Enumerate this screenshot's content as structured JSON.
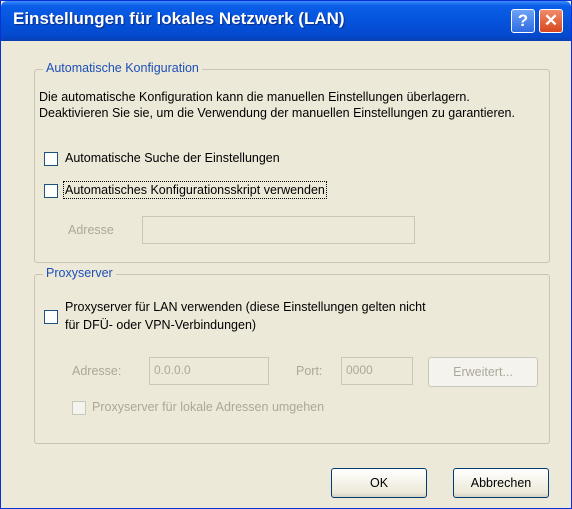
{
  "dialog": {
    "title": "Einstellungen für lokales Netzwerk (LAN)",
    "help_glyph": "?",
    "close_glyph": "✕"
  },
  "auto_config": {
    "group_label": "Automatische Konfiguration",
    "description": "Die automatische Konfiguration kann die manuellen Einstellungen überlagern. Deaktivieren Sie sie, um die Verwendung der manuellen Einstellungen zu garantieren.",
    "auto_detect_label": "Automatische Suche der Einstellungen",
    "auto_detect_checked": false,
    "use_script_label": "Automatisches Konfigurationsskript verwenden",
    "use_script_checked": false,
    "address_label": "Adresse",
    "address_value": ""
  },
  "proxy": {
    "group_label": "Proxyserver",
    "use_proxy_label_line1": "Proxyserver für LAN verwenden (diese Einstellungen gelten nicht",
    "use_proxy_label_line2": "für DFÜ- oder VPN-Verbindungen)",
    "use_proxy_checked": false,
    "address_label": "Adresse:",
    "address_value": "0.0.0.0",
    "port_label": "Port:",
    "port_value": "0000",
    "advanced_label": "Erweitert...",
    "bypass_label": "Proxyserver für lokale Adressen umgehen",
    "bypass_checked": false
  },
  "buttons": {
    "ok_label": "OK",
    "cancel_label": "Abbrechen"
  }
}
